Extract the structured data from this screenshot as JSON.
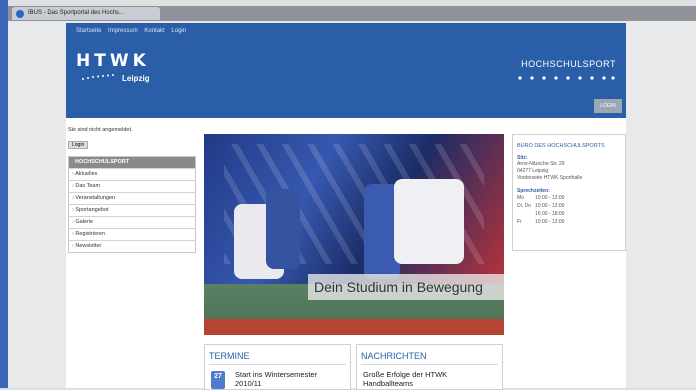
{
  "browser": {
    "tab_title": "IBUS - Das Sportportal des Hochs..."
  },
  "header": {
    "nav": [
      "Startseite",
      "Impressum",
      "Kontakt",
      "Login"
    ],
    "logo_text": "HTWK",
    "logo_city": "Leipzig",
    "site_title": "HOCHSCHULSPORT",
    "login_button": "LOGIN",
    "colors": {
      "header_blue": "#2b5ea8"
    }
  },
  "sidebar": {
    "notice": "Sie sind nicht angemeldet.",
    "login_link": "Login",
    "menu_title": "HOCHSCHULSPORT",
    "items": [
      "Aktuelles",
      "Das Team",
      "Veranstaltungen",
      "Sportangebot",
      "Galerie",
      "Registrieren",
      "Newsletter"
    ]
  },
  "hero": {
    "slogan": "Dein Studium in Bewegung"
  },
  "office": {
    "title": "BÜRO DES HOCHSCHULSPORTS",
    "address_label": "Sitz:",
    "address_lines": [
      "Arno-Nitzsche-Str. 29",
      "04277 Leipzig",
      "Vorderseite HTWK Sporthalle"
    ],
    "hours_label": "Sprechzeiten:",
    "hours": [
      {
        "day": "Mo",
        "time": "10:00 - 12:00"
      },
      {
        "day": "Di, Do",
        "time": "10:00 - 12:00"
      },
      {
        "day": "",
        "time": "16:00 - 18:00"
      },
      {
        "day": "Fr",
        "time": "10:00 - 12:00"
      }
    ]
  },
  "termine": {
    "title": "TERMINE",
    "date_day": "27",
    "entry": "Start ins Wintersemester 2010/11"
  },
  "news": {
    "title": "NACHRICHTEN",
    "entry": "Große Erfolge der HTWK Handballteams"
  }
}
